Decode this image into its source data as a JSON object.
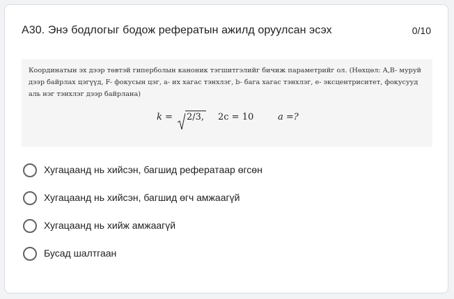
{
  "question": {
    "title": "А30.  Энэ бодлогыг бодож рефератын ажилд оруулсан эсэх",
    "points": "0/10"
  },
  "image": {
    "text": "Координатын эх дээр төвтэй гиперболын каноник тэгшитгэлийг бичиж параметрийг ол. (Нөхцөл: A,B- муруй дээр байрлах цэгүүд, F- фокусын цэг, a- их хагас тэнхлэг, b- бага хагас тэнхлэг, e- эксцентриситет, фокусууд аль нэг тэнхлэг дээр байрлана)",
    "formula": {
      "k_label": "k =",
      "sqrt_content": "2/3,",
      "c_part": "2c = 10",
      "a_part": "a =?"
    }
  },
  "options": [
    {
      "label": "Хугацаанд нь хийсэн, багшид рефератаар өгсөн"
    },
    {
      "label": "Хугацаанд нь хийсэн, багшид өгч амжаагүй"
    },
    {
      "label": "Хугацаанд нь хийж амжаагүй"
    },
    {
      "label": "Бусад шалтгаан"
    }
  ]
}
